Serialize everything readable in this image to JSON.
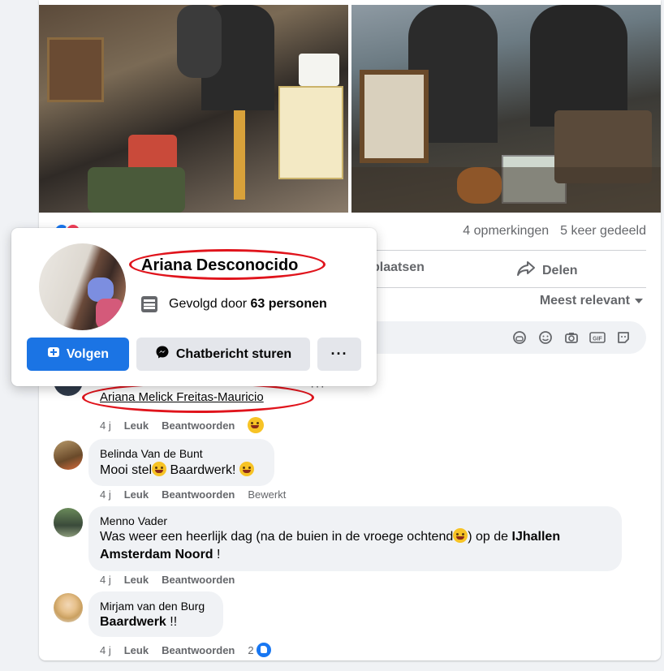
{
  "post": {
    "stats": {
      "comments": "4 opmerkingen",
      "shares": "5 keer gedeeld"
    },
    "actions": {
      "comment": "plaatsen",
      "share": "Delen"
    },
    "sort": "Meest relevant"
  },
  "hovercard": {
    "name": "Ariana Desconocido",
    "followed_prefix": "Gevolgd door",
    "followed_count": "63 personen",
    "follow_button": "Volgen",
    "chat_button": "Chatbericht sturen",
    "more_button": "···"
  },
  "comments": [
    {
      "author": "Ariana Melick Freitas-Mauricio",
      "time": "4 j",
      "like": "Leuk",
      "reply": "Beantwoorden"
    },
    {
      "author": "Belinda Van de Bunt",
      "text_a": "Mooi stel",
      "text_b": " Baardwerk! ",
      "time": "4 j",
      "like": "Leuk",
      "reply": "Beantwoorden",
      "edited": "Bewerkt"
    },
    {
      "author": "Menno Vader",
      "text_a": "Was weer een heerlijk dag (na de buien in de vroege ochtend",
      "text_b": ") op de ",
      "text_bold_1": "IJhallen",
      "text_bold_2": "Amsterdam Noord",
      "text_c": " !",
      "time": "4 j",
      "like": "Leuk",
      "reply": "Beantwoorden"
    },
    {
      "author": "Mirjam van den Burg",
      "text_bold": "Baardwerk",
      "text_c": " !!",
      "time": "4 j",
      "like": "Leuk",
      "reply": "Beantwoorden",
      "likes": "2"
    }
  ],
  "colors": {
    "accent": "#1b74e4",
    "annotation": "#e0141c",
    "bubble": "#f0f2f5"
  }
}
